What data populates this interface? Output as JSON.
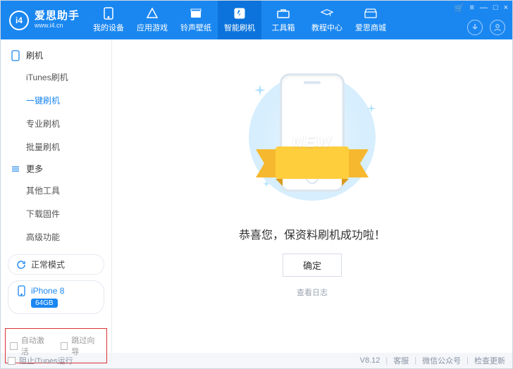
{
  "header": {
    "logo": {
      "badge": "i4",
      "title": "爱思助手",
      "subtitle": "www.i4.cn"
    },
    "nav": [
      {
        "label": "我的设备"
      },
      {
        "label": "应用游戏"
      },
      {
        "label": "铃声壁纸"
      },
      {
        "label": "智能刷机"
      },
      {
        "label": "工具箱"
      },
      {
        "label": "教程中心"
      },
      {
        "label": "爱思商城"
      }
    ],
    "win": {
      "cart": "🛒",
      "menu": "≡",
      "min": "—",
      "max": "□",
      "close": "×"
    }
  },
  "sidebar": {
    "group1": {
      "title": "刷机",
      "items": [
        "iTunes刷机",
        "一键刷机",
        "专业刷机",
        "批量刷机"
      ]
    },
    "group2": {
      "title": "更多",
      "items": [
        "其他工具",
        "下载固件",
        "高级功能"
      ]
    },
    "mode_label": "正常模式",
    "device_name": "iPhone 8",
    "storage_badge": "64GB",
    "auto_activate": "自动激活",
    "skip_setup": "跳过向导"
  },
  "main": {
    "new_label": "NEW",
    "message": "恭喜您，保资料刷机成功啦！",
    "ok_label": "确定",
    "log_label": "查看日志"
  },
  "footer": {
    "left_chk": "阻止iTunes运行",
    "version": "V8.12",
    "links": [
      "客服",
      "微信公众号",
      "检查更新"
    ]
  }
}
